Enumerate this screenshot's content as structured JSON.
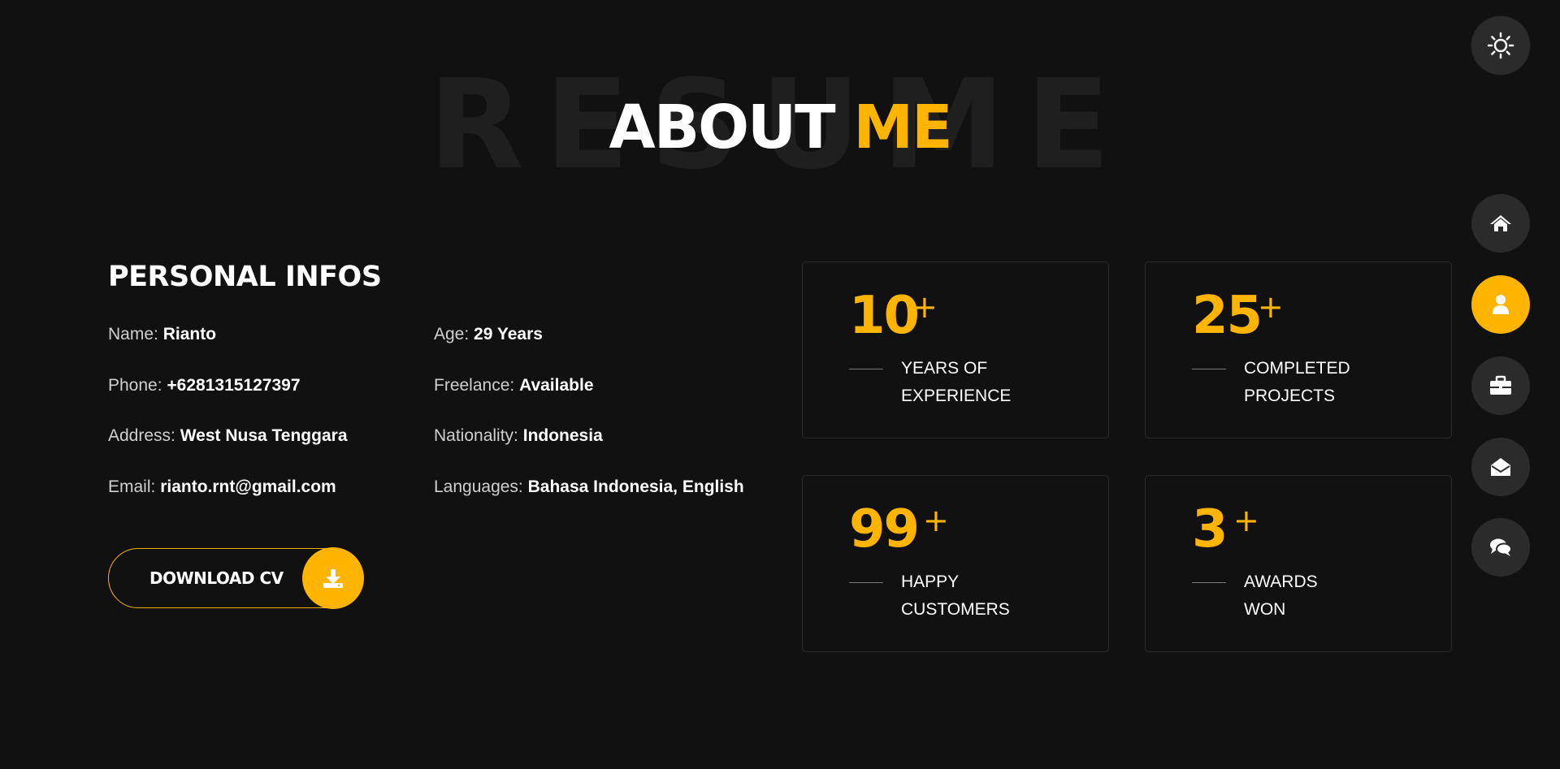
{
  "header": {
    "background_word": "RESUME",
    "title_white": "ABOUT",
    "title_accent": "ME",
    "accent_color": "#ffb400"
  },
  "personal": {
    "heading": "PERSONAL INFOS",
    "fields": [
      {
        "key": "Name:",
        "value": "Rianto"
      },
      {
        "key": "Age:",
        "value": "29 Years"
      },
      {
        "key": "Phone:",
        "value": "+6281315127397"
      },
      {
        "key": "Freelance:",
        "value": "Available"
      },
      {
        "key": "Address:",
        "value": "West Nusa Tenggara"
      },
      {
        "key": "Nationality:",
        "value": "Indonesia"
      },
      {
        "key": "Email:",
        "value": "rianto.rnt@gmail.com"
      },
      {
        "key": "Languages:",
        "value": "Bahasa Indonesia, English"
      }
    ],
    "download_label": "DOWNLOAD CV",
    "download_icon": "download-icon"
  },
  "stats": [
    {
      "number": "10",
      "plus": "+",
      "line1": "YEARS OF",
      "line2": "EXPERIENCE"
    },
    {
      "number": "25",
      "plus": "+",
      "line1": "COMPLETED",
      "line2": "PROJECTS"
    },
    {
      "number": "99",
      "plus": "+",
      "line1": "HAPPY",
      "line2": "CUSTOMERS"
    },
    {
      "number": "3",
      "plus": "+",
      "line1": "AWARDS",
      "line2": "WON"
    }
  ],
  "sidenav": {
    "theme_icon": "sun-icon",
    "items": [
      {
        "icon": "home-icon",
        "active": false
      },
      {
        "icon": "user-icon",
        "active": true
      },
      {
        "icon": "briefcase-icon",
        "active": false
      },
      {
        "icon": "envelope-open-icon",
        "active": false
      },
      {
        "icon": "comments-icon",
        "active": false
      }
    ],
    "active_color": "#ffb400",
    "inactive_color": "#2b2b2b"
  }
}
